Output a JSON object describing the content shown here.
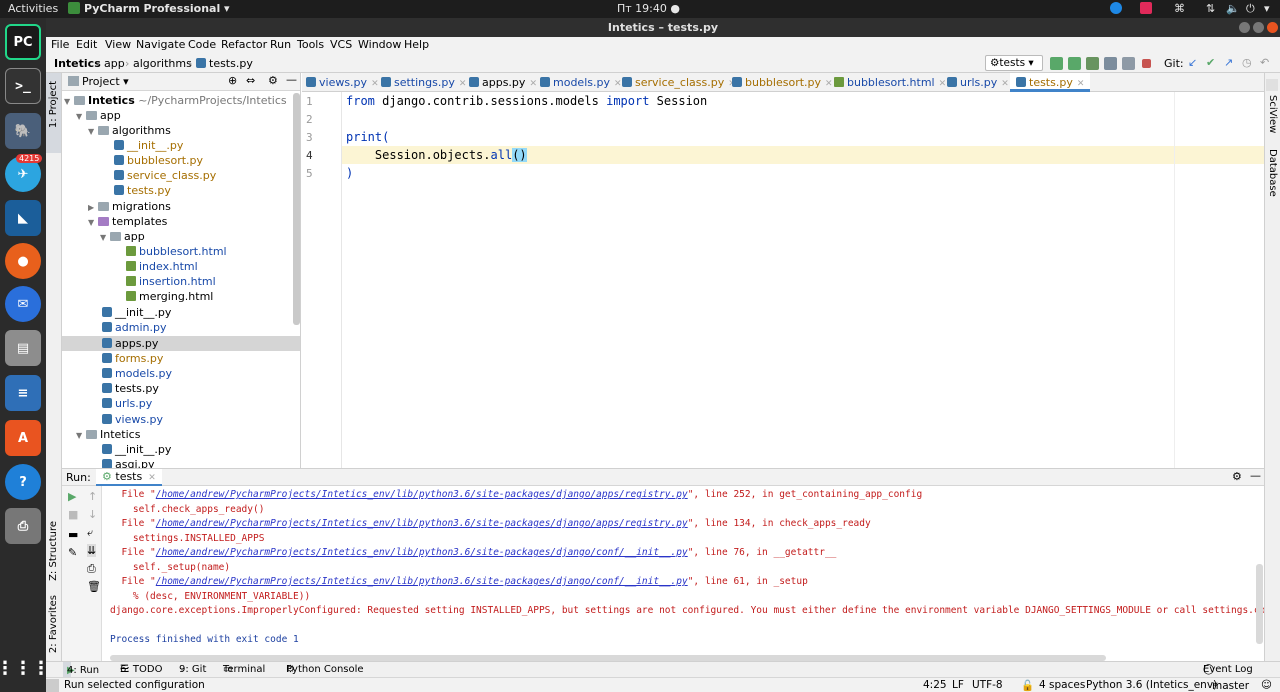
{
  "topbar": {
    "activities": "Activities",
    "app_name": "PyCharm Professional",
    "clock": "Пт 19:40 ●"
  },
  "dock": {
    "telegram_badge": "4215"
  },
  "window": {
    "title": "Intetics – tests.py"
  },
  "menu": [
    "File",
    "Edit",
    "View",
    "Navigate",
    "Code",
    "Refactor",
    "Run",
    "Tools",
    "VCS",
    "Window",
    "Help"
  ],
  "nav": {
    "crumbs": [
      "Intetics",
      "app",
      "algorithms",
      "tests.py"
    ],
    "run_config": "tests",
    "git_label": "Git:"
  },
  "project": {
    "header": "Project",
    "root_name": "Intetics",
    "root_path": "~/PycharmProjects/Intetics",
    "tree": [
      "app",
      "algorithms",
      "__init__.py",
      "bubblesort.py",
      "service_class.py",
      "tests.py",
      "migrations",
      "templates",
      "app",
      "bubblesort.html",
      "index.html",
      "insertion.html",
      "merging.html",
      "__init__.py",
      "admin.py",
      "apps.py",
      "forms.py",
      "models.py",
      "tests.py",
      "urls.py",
      "views.py",
      "Intetics",
      "__init__.py",
      "asgi.py"
    ]
  },
  "tabs": [
    "views.py",
    "settings.py",
    "apps.py",
    "models.py",
    "service_class.py",
    "bubblesort.py",
    "bubblesort.html",
    "urls.py",
    "tests.py"
  ],
  "editor": {
    "line_numbers": [
      "1",
      "2",
      "3",
      "4",
      "5"
    ],
    "l1_kw1": "from",
    "l1_mod": " django.contrib.sessions.models ",
    "l1_kw2": "import",
    "l1_name": " Session",
    "l3_fn": "print",
    "l3_paren": "(",
    "l4_obj": "    Session.objects.",
    "l4_call": "all",
    "l4_paren": "()",
    "l5_paren": ")"
  },
  "left_tools": {
    "project": "1: Project",
    "structure": "Z: Structure",
    "favorites": "2: Favorites"
  },
  "right_tools": {
    "sciview": "SciView",
    "database": "Database"
  },
  "run": {
    "label": "Run:",
    "tab": "tests",
    "console": [
      {
        "pre": "  File \"",
        "link": "/home/andrew/PycharmProjects/Intetics_env/lib/python3.6/site-packages/django/apps/registry.py",
        "post": "\", line 252, in get_containing_app_config"
      },
      {
        "text": "    self.check_apps_ready()"
      },
      {
        "pre": "  File \"",
        "link": "/home/andrew/PycharmProjects/Intetics_env/lib/python3.6/site-packages/django/apps/registry.py",
        "post": "\", line 134, in check_apps_ready"
      },
      {
        "text": "    settings.INSTALLED_APPS"
      },
      {
        "pre": "  File \"",
        "link": "/home/andrew/PycharmProjects/Intetics_env/lib/python3.6/site-packages/django/conf/__init__.py",
        "post": "\", line 76, in __getattr__"
      },
      {
        "text": "    self._setup(name)"
      },
      {
        "pre": "  File \"",
        "link": "/home/andrew/PycharmProjects/Intetics_env/lib/python3.6/site-packages/django/conf/__init__.py",
        "post": "\", line 61, in _setup"
      },
      {
        "text": "    % (desc, ENVIRONMENT_VARIABLE))"
      },
      {
        "text": "django.core.exceptions.ImproperlyConfigured: Requested setting INSTALLED_APPS, but settings are not configured. You must either define the environment variable DJANGO_SETTINGS_MODULE or call settings.configure"
      }
    ],
    "exit_msg": "Process finished with exit code 1"
  },
  "bottom_tools": [
    "4: Run",
    "6: TODO",
    "9: Git",
    "Terminal",
    "Python Console",
    "Event Log"
  ],
  "status": {
    "message": "Run selected configuration",
    "position": "4:25",
    "line_sep": "LF",
    "encoding": "UTF-8",
    "indent": "4 spaces",
    "interpreter": "Python 3.6 (Intetics_env)",
    "branch": "master"
  },
  "colors": {
    "keyword": "#0033b3",
    "current_line": "#fcf5d4",
    "error_text": "#c21c1c",
    "link": "#2a35c8"
  }
}
